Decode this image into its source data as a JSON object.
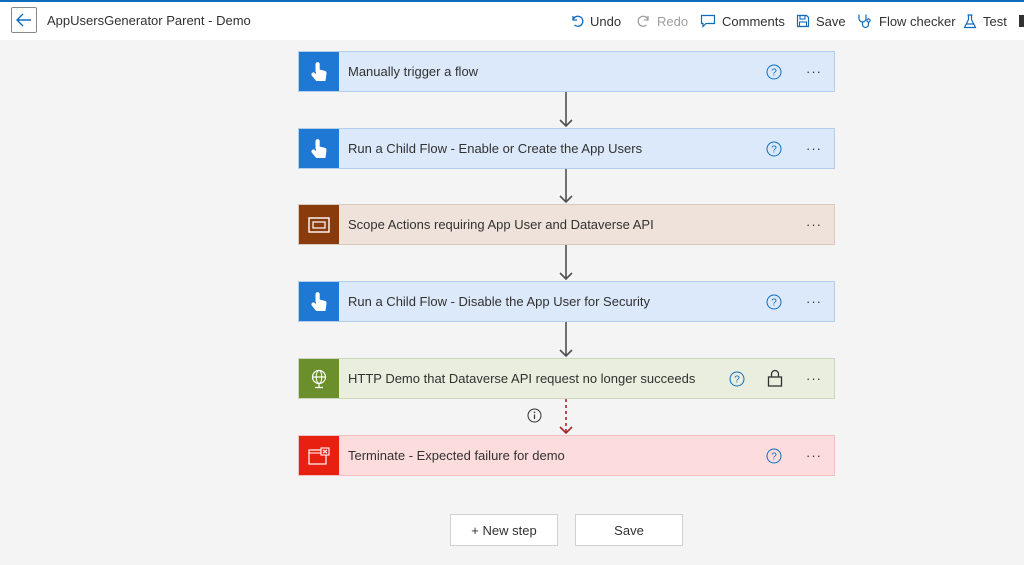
{
  "header": {
    "title": "AppUsersGenerator Parent - Demo",
    "toolbar": {
      "undo": "Undo",
      "redo": "Redo",
      "comments": "Comments",
      "save": "Save",
      "flow_checker": "Flow checker",
      "test": "Test"
    }
  },
  "flow": {
    "steps": [
      {
        "label": "Manually trigger a flow",
        "icon": "touch-trigger-icon",
        "color": "#1e78d4",
        "has_help": true,
        "has_lock": false
      },
      {
        "label": "Run a Child Flow - Enable or Create the App Users",
        "icon": "touch-trigger-icon",
        "color": "#1e78d4",
        "has_help": true,
        "has_lock": false
      },
      {
        "label": "Scope Actions requiring App User and Dataverse API",
        "icon": "scope-icon",
        "color": "#8a3b0c",
        "has_help": false,
        "has_lock": false
      },
      {
        "label": "Run a Child Flow - Disable the App User for Security",
        "icon": "touch-trigger-icon",
        "color": "#1e78d4",
        "has_help": true,
        "has_lock": false
      },
      {
        "label": "HTTP Demo that Dataverse API request no longer succeeds",
        "icon": "globe-icon",
        "color": "#6a8f2c",
        "has_help": true,
        "has_lock": true
      },
      {
        "label": "Terminate - Expected failure for demo",
        "icon": "terminate-icon",
        "color": "#e8200f",
        "has_help": true,
        "has_lock": false
      }
    ],
    "more_glyph": "···"
  },
  "footer": {
    "new_step": "+ New step",
    "save": "Save"
  }
}
